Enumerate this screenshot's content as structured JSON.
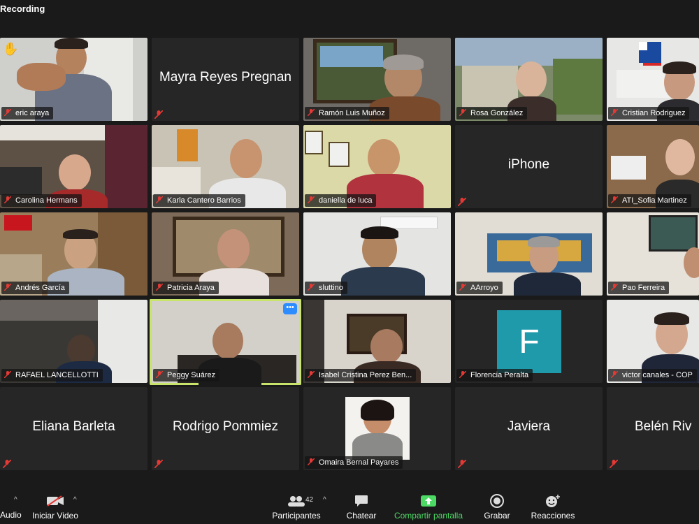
{
  "recording_label": "Recording",
  "tiles": [
    {
      "name": "eric araya"
    },
    {
      "name": "Mayra Reyes Pregnan",
      "big": "Mayra Reyes Pregnan"
    },
    {
      "name": "Ramón Luis Muñoz"
    },
    {
      "name": "Rosa González"
    },
    {
      "name": "Cristian Rodriguez"
    },
    {
      "name": "Carolina Hermans"
    },
    {
      "name": "Karla Cantero Barrios"
    },
    {
      "name": "daniella de luca"
    },
    {
      "name": "iPhone",
      "big": "iPhone"
    },
    {
      "name": "ATI_Sofia Martinez"
    },
    {
      "name": "Andrés García"
    },
    {
      "name": "Patricia Araya"
    },
    {
      "name": "sluttino"
    },
    {
      "name": "AArroyo"
    },
    {
      "name": "Pao Ferreira"
    },
    {
      "name": "RAFAEL LANCELLOTTI"
    },
    {
      "name": "Peggy Suárez"
    },
    {
      "name": "Isabel Cristina Perez Ben..."
    },
    {
      "name": "Florencia Peralta",
      "avatar_letter": "F"
    },
    {
      "name": "victor canales - COP"
    },
    {
      "big": "Eliana Barleta"
    },
    {
      "big": "Rodrigo Pommiez"
    },
    {
      "name": "Omaira Bernal Payares"
    },
    {
      "big": "Javiera"
    },
    {
      "big": "Belén Riv"
    }
  ],
  "toolbar": {
    "audio": "Audio",
    "video": "Iniciar Video",
    "participants": "Participantes",
    "participant_count": "42",
    "chat": "Chatear",
    "share": "Compartir pantalla",
    "record": "Grabar",
    "reactions": "Reacciones"
  },
  "colors": {
    "active_speaker": "#c9e46b",
    "share_green": "#4cd964",
    "avatar_teal": "#1f9aab",
    "mute_red": "#e53935"
  }
}
